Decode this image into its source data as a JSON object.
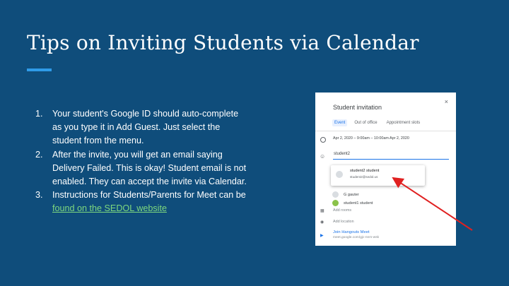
{
  "slide": {
    "title": "Tips on Inviting Students via Calendar",
    "accent_color": "#2f9be8",
    "background_color": "#0f4d7b"
  },
  "tips": [
    {
      "number": "1.",
      "text": "Your student's Google ID should auto-complete as you type it in Add Guest. Just select the student from the menu."
    },
    {
      "number": "2.",
      "text": "After the invite, you will get an email saying Delivery Failed. This is okay! Student email is not enabled. They can accept the invite via Calendar."
    },
    {
      "number": "3.",
      "text": "Instructions for Students/Parents for Meet can be ",
      "link_text": "found on the SEDOL website",
      "link_color": "#7ed87e"
    }
  ],
  "screenshot": {
    "dialog_title": "Student invitation",
    "close_glyph": "×",
    "tabs": [
      "Event",
      "Out of office",
      "Appointment slots"
    ],
    "active_tab": "Event",
    "datetime": "Apr 2, 2020  –  9:00am  –  10:00am   Apr 2, 2020",
    "guest_input_value": "student2",
    "suggestion": {
      "name": "student2 student",
      "email": "student2@sedol.us"
    },
    "guests": [
      {
        "name": "G gauter",
        "avatar_color": "#d9dde1"
      },
      {
        "name": "student1 student",
        "avatar_color": "#8bc34a"
      }
    ],
    "add_rooms": "Add rooms",
    "add_location": "Add location",
    "meet_link": "Join Hangouts Meet",
    "meet_url": "meet.google.com/gjc-nnm-wsk",
    "arrow_color": "#e02020"
  }
}
